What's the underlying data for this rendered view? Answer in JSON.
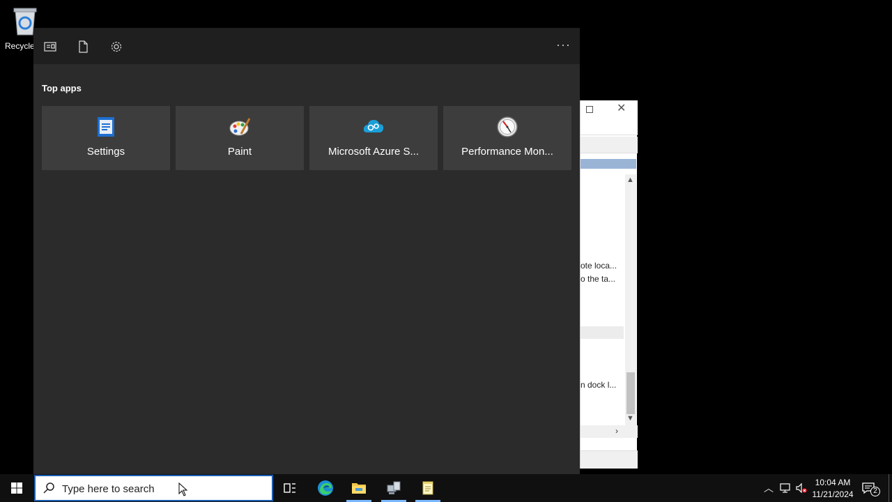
{
  "desktop": {
    "recycle_bin_label": "Recycle"
  },
  "background_window": {
    "lines": [
      "ote loca...",
      "o the ta...",
      "n dock l..."
    ]
  },
  "search_panel": {
    "toolbar_icons": [
      "apps-icon",
      "documents-icon",
      "settings-gear-icon"
    ],
    "more_label": "···",
    "section_title": "Top apps",
    "top_apps": [
      {
        "label": "Settings",
        "icon": "settings-app-icon"
      },
      {
        "label": "Paint",
        "icon": "paint-palette-icon"
      },
      {
        "label": "Microsoft Azure S...",
        "icon": "azure-cloud-gear-icon"
      },
      {
        "label": "Performance Mon...",
        "icon": "performance-gauge-icon"
      }
    ]
  },
  "taskbar": {
    "search_placeholder": "Type here to search",
    "pinned": [
      {
        "name": "task-view",
        "icon": "task-view-icon"
      },
      {
        "name": "edge",
        "icon": "edge-icon"
      },
      {
        "name": "file-explorer",
        "icon": "folder-icon"
      },
      {
        "name": "network-tool",
        "icon": "network-computer-icon"
      },
      {
        "name": "notepad",
        "icon": "notepad-icon"
      }
    ],
    "clock_time": "10:04 AM",
    "clock_date": "11/21/2024",
    "notification_count": "2"
  },
  "colors": {
    "panel_bg": "#2b2b2b",
    "tile_bg": "#3d3d3d",
    "taskbar_bg": "#101010",
    "accent": "#0078d7"
  }
}
